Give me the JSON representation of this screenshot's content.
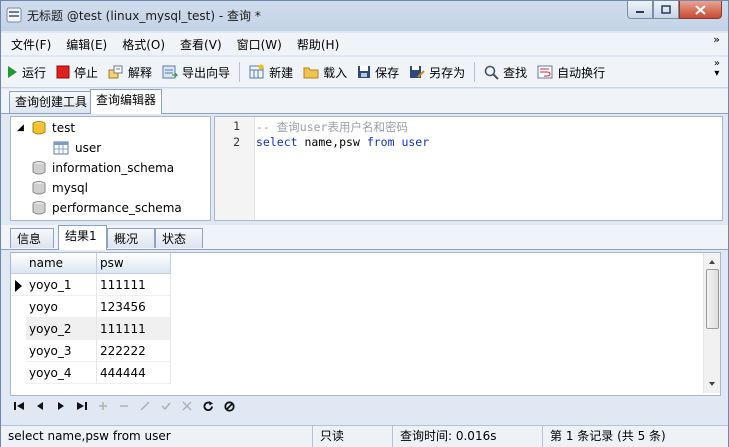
{
  "window": {
    "title": "无标题 @test (linux_mysql_test) - 查询 *",
    "buttons": [
      "minimize",
      "maximize",
      "close"
    ]
  },
  "menu": [
    "文件(F)",
    "编辑(E)",
    "格式(O)",
    "查看(V)",
    "窗口(W)",
    "帮助(H)"
  ],
  "toolbar": {
    "run": "运行",
    "stop": "停止",
    "explain": "解释",
    "export_wizard": "导出向导",
    "new": "新建",
    "load": "载入",
    "save": "保存",
    "save_as": "另存为",
    "find": "查找",
    "word_wrap": "自动换行"
  },
  "editor_tabs": [
    "查询创建工具",
    "查询编辑器"
  ],
  "tree": {
    "databases": [
      {
        "name": "test",
        "expanded": true,
        "tables": [
          "user"
        ]
      },
      {
        "name": "information_schema"
      },
      {
        "name": "mysql"
      },
      {
        "name": "performance_schema"
      }
    ]
  },
  "sql_editor": {
    "line_numbers": [
      "1",
      "2"
    ],
    "line1_comment": "-- 查询user表用户名和密码",
    "line2": {
      "select": "select",
      "columns": "name,psw",
      "from": "from",
      "table": "user"
    }
  },
  "result_tabs": [
    "信息",
    "结果1",
    "概况",
    "状态"
  ],
  "result_grid": {
    "columns": [
      "name",
      "psw"
    ],
    "rows": [
      [
        "yoyo_1",
        "111111"
      ],
      [
        "yoyo",
        "123456"
      ],
      [
        "yoyo_2",
        "111111"
      ],
      [
        "yoyo_3",
        "222222"
      ],
      [
        "yoyo_4",
        "444444"
      ]
    ],
    "current_row": 0
  },
  "navigator": [
    "first",
    "prev",
    "next",
    "last",
    "add",
    "delete",
    "edit",
    "apply",
    "cancel",
    "refresh",
    "stop"
  ],
  "status": {
    "sql": "select name,psw from user",
    "mode": "只读",
    "query_time": "查询时间: 0.016s",
    "record": "第 1 条记录 (共 5 条)"
  },
  "colors": {
    "keyword": "#1030c8",
    "comment": "#9aa1a8",
    "stop_red": "#e02020",
    "run_green": "#1f9a2a"
  }
}
